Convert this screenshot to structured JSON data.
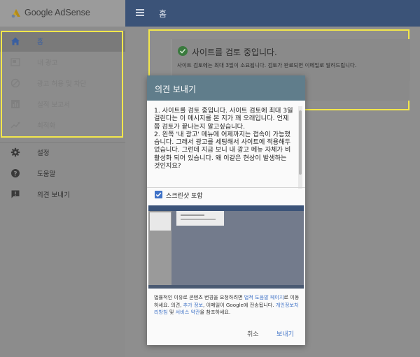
{
  "app": {
    "brand": "Google AdSense"
  },
  "sidebar": {
    "items": [
      {
        "label": "홈",
        "icon": "home-icon"
      },
      {
        "label": "내 광고",
        "icon": "ad-unit-icon"
      },
      {
        "label": "광고 허용 및 차단",
        "icon": "block-icon"
      },
      {
        "label": "실적 보고서",
        "icon": "bar-chart-icon"
      },
      {
        "label": "최적화",
        "icon": "trending-icon"
      },
      {
        "label": "설정",
        "icon": "gear-icon"
      },
      {
        "label": "도움말",
        "icon": "help-icon"
      },
      {
        "label": "의견 보내기",
        "icon": "feedback-icon"
      }
    ]
  },
  "header": {
    "title": "홈"
  },
  "status_card": {
    "title": "사이트를 검토 중입니다.",
    "message": "사이트 검토에는 최대 3일이 소요됩니다. 검토가 완료되면 이메일로 알려드립니다."
  },
  "feedback_dialog": {
    "title": "의견 보내기",
    "feedback_text": [
      "1. 사이트를 검토 중입니다. 사이트 검토에 최대 3일 걸린다는 이 메시지를 본 지가 꽤 오래입니다. 언제쯤 검토가 끝나는지 알고싶습니다.",
      "2. 왼쪽 '내 광고' 메뉴에 어제까지는 접속이 가능했습니다. 그래서 광고를 세팅해서 사이트에 적용해두었습니다. 그런데 지금 보니 내 광고 메뉴 자체가 비활성화 되어 있습니다. 왜 이같은 현상이 발생하는 것인지요?"
    ],
    "include_screenshot_label": "스크린샷 포함",
    "include_screenshot_checked": true,
    "legal": {
      "part1": "법률적인 이유로 콘텐츠 변경을 요청하려면 ",
      "link1": "법적 도움말 페이지",
      "part2": "로 이동하세요. 의견, ",
      "link2": "추가 정보",
      "part3": ", 이메일이 Google에 전송됩니다. ",
      "link3": "개인정보처리방침",
      "part4": " 및 ",
      "link4": "서비스 약관",
      "part5": "을 참조하세요."
    },
    "cancel_label": "취소",
    "send_label": "보내기"
  },
  "colors": {
    "header_bg": "#3b5378",
    "dialog_header": "#607d8b",
    "accent": "#3f72c7",
    "highlight_border": "#f3e74b",
    "success": "#3a7a3e"
  }
}
